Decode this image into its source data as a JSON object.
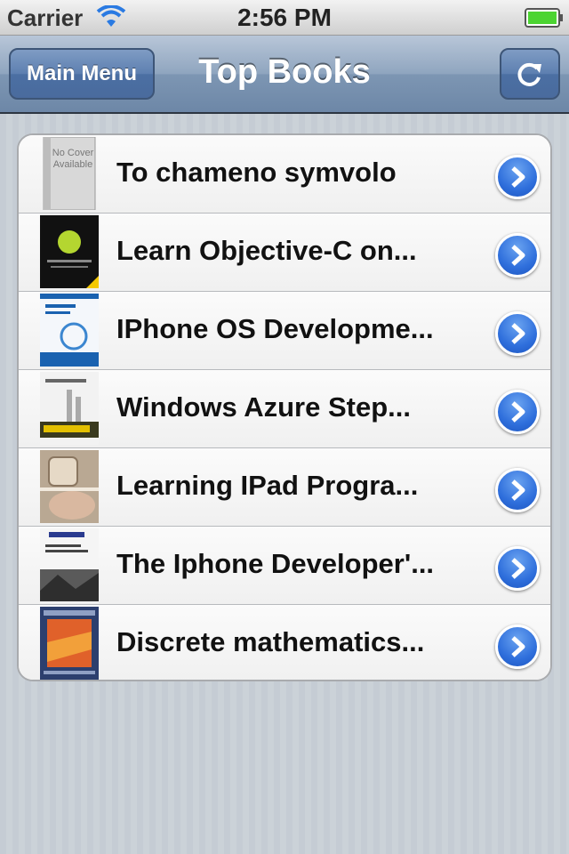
{
  "status_bar": {
    "carrier": "Carrier",
    "time": "2:56 PM",
    "wifi_icon": "wifi-icon",
    "battery_icon": "battery-icon",
    "battery_color": "#4cd432"
  },
  "nav_bar": {
    "title": "Top Books",
    "left_button": "Main Menu",
    "right_button_icon": "refresh-icon"
  },
  "books": [
    {
      "title": "To chameno symvolo",
      "cover_text": "No Cover Available"
    },
    {
      "title": "Learn Objective-C on..."
    },
    {
      "title": "IPhone OS Developme..."
    },
    {
      "title": "Windows Azure Step..."
    },
    {
      "title": "Learning IPad Progra..."
    },
    {
      "title": "The Iphone Developer'..."
    },
    {
      "title": "Discrete mathematics..."
    }
  ],
  "accent_color": "#2f6fdc"
}
